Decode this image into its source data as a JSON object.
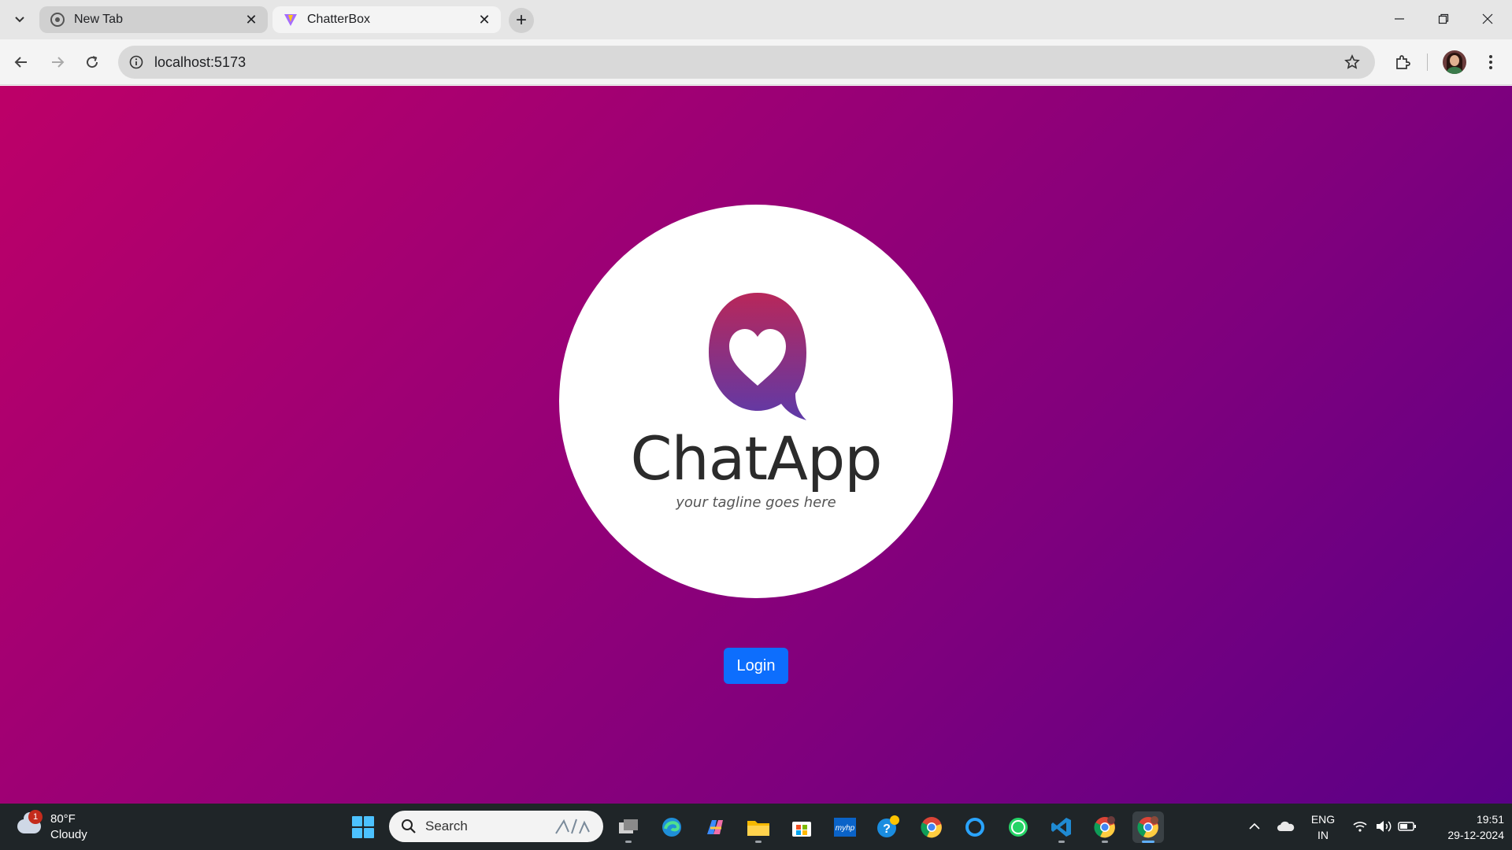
{
  "browser": {
    "tabs": [
      {
        "title": "New Tab",
        "active": false
      },
      {
        "title": "ChatterBox",
        "active": true
      }
    ],
    "address": "localhost:5173"
  },
  "page": {
    "logo": {
      "brand_name": "ChatApp",
      "tagline": "your tagline goes here",
      "icon": "heart-chat-bubble-icon"
    },
    "login_label": "Login",
    "colors": {
      "gradient_start": "#bd0068",
      "gradient_end": "#5a0087",
      "login_button": "#0d6efd"
    }
  },
  "taskbar": {
    "weather": {
      "temperature": "80°F",
      "condition": "Cloudy",
      "badge": "1"
    },
    "search_placeholder": "Search",
    "apps": [
      "task-view",
      "edge",
      "copilot",
      "file-explorer",
      "microsoft-store",
      "myhp",
      "get-help",
      "chrome",
      "cortana",
      "whatsapp",
      "vscode",
      "chrome-profile",
      "chrome-active"
    ],
    "language": {
      "line1": "ENG",
      "line2": "IN"
    },
    "clock": {
      "time": "19:51",
      "date": "29-12-2024"
    }
  }
}
